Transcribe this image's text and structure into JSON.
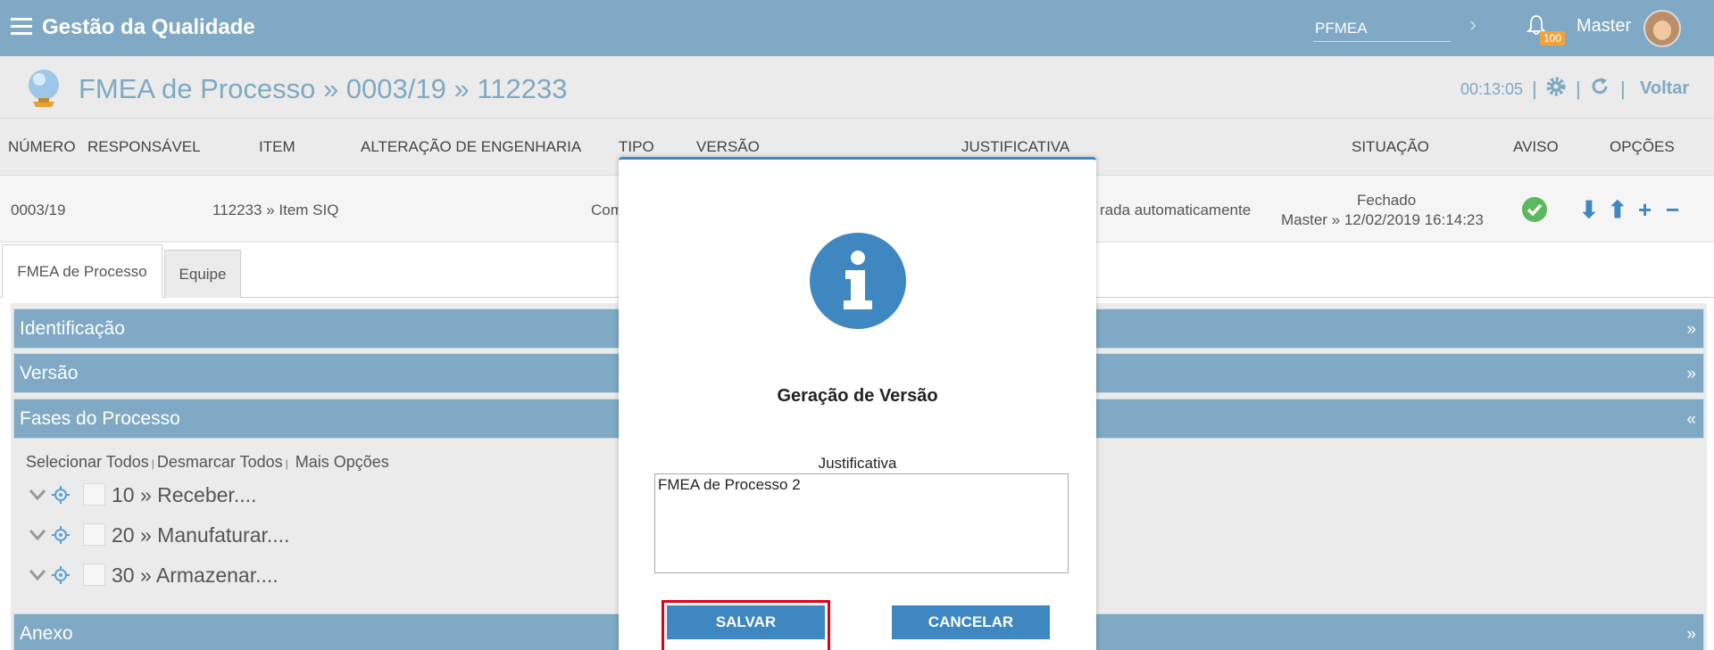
{
  "topbar": {
    "title": "Gestão da Qualidade",
    "module_input": "PFMEA",
    "notification_count": "100",
    "user": "Master"
  },
  "header": {
    "title": "FMEA de Processo » 0003/19 » 112233",
    "timer": "00:13:05",
    "separator": "|",
    "back_label": "Voltar"
  },
  "table": {
    "columns": [
      "NÚMERO",
      "RESPONSÁVEL",
      "ITEM",
      "ALTERAÇÃO DE ENGENHARIA",
      "TIPO",
      "VERSÃO",
      "JUSTIFICATIVA",
      "SITUAÇÃO",
      "AVISO",
      "OPÇÕES"
    ],
    "row": {
      "numero": "0003/19",
      "responsavel": "",
      "item": "112233 » Item SIQ",
      "tipo": "Com",
      "justificativa": "rada automaticamente",
      "situacao_status": "Fechado",
      "situacao_detail": "Master » 12/02/2019 16:14:23"
    },
    "options_icons": [
      "arrow-down-icon",
      "arrow-up-icon",
      "plus-icon",
      "minus-icon"
    ]
  },
  "tabs": [
    "FMEA de Processo",
    "Equipe"
  ],
  "panels": {
    "identificacao": "Identificação",
    "versao": "Versão",
    "fases": "Fases do Processo",
    "anexo": "Anexo",
    "collapsed_chevron": "»",
    "expanded_chevron": "«"
  },
  "selection_links": {
    "select_all": "Selecionar Todos",
    "deselect_all": "Desmarcar Todos",
    "more": "Mais Opções"
  },
  "phases": [
    "10 » Receber....",
    "20 » Manufaturar....",
    "30 » Armazenar...."
  ],
  "modal": {
    "title": "Geração de Versão",
    "field_label": "Justificativa",
    "field_value": "FMEA de Processo 2",
    "save_label": "SALVAR",
    "cancel_label": "CANCELAR"
  },
  "colors": {
    "topbar": "#7fa9c4",
    "accent": "#3e87c0",
    "success": "#5cb85c",
    "highlight": "#e0001b"
  }
}
